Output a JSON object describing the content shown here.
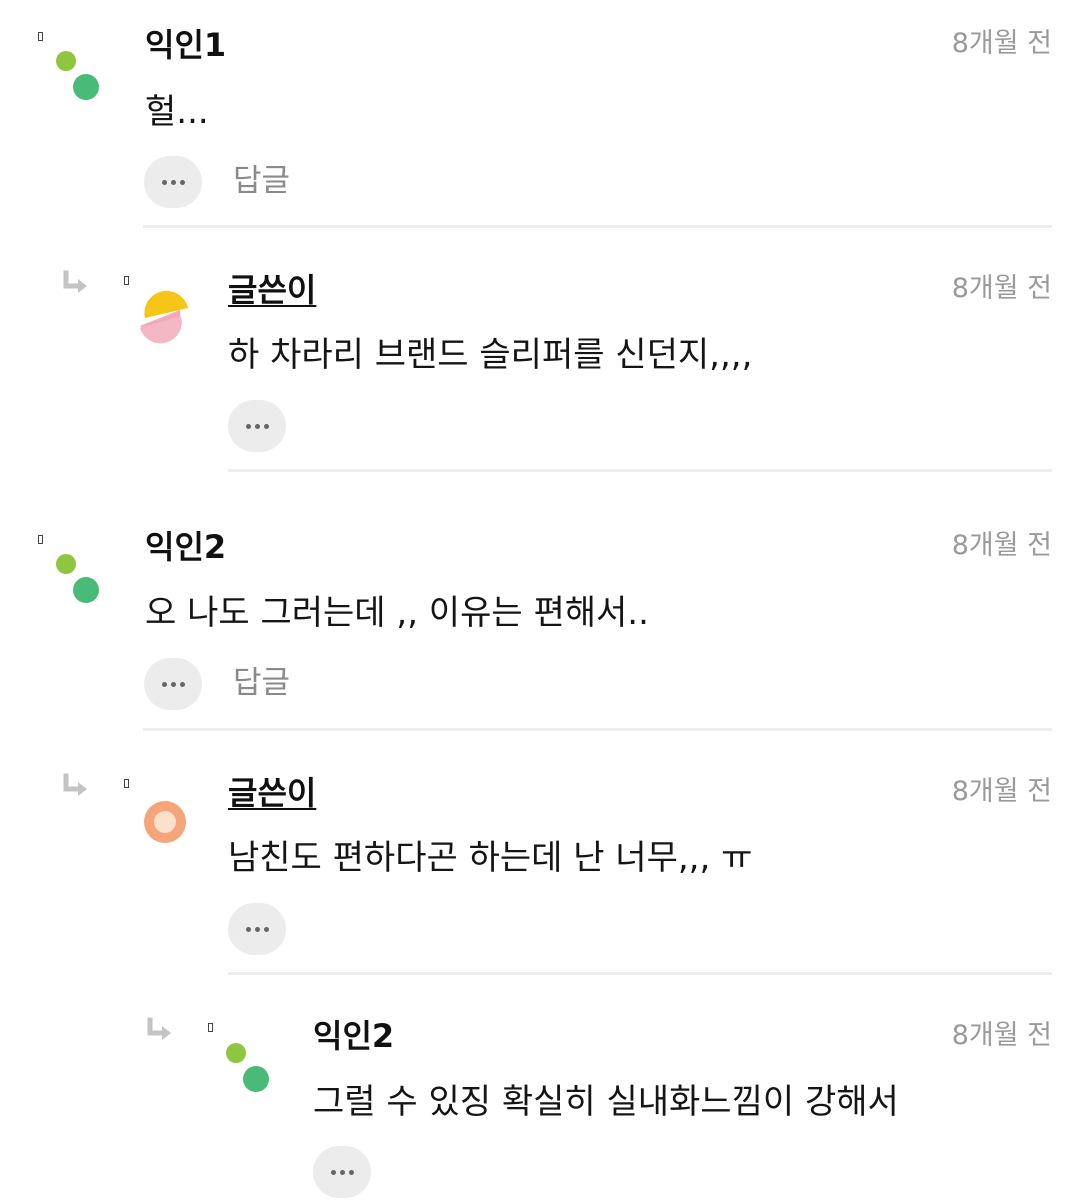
{
  "comments": [
    {
      "author": "익인1",
      "time": "8개월 전",
      "text": "헐...",
      "reply_label": "답글",
      "more_icon": "ellipsis-icon",
      "avatar_colors": [
        "#8fc540",
        "#48bb78"
      ]
    },
    {
      "author": "글쓴이",
      "time": "8개월 전",
      "text": "하 차라리 브랜드 슬리퍼를 신던지,,,,",
      "more_icon": "ellipsis-icon",
      "avatar_colors": [
        "#f5c518",
        "#f4a9b8"
      ]
    },
    {
      "author": "익인2",
      "time": "8개월 전",
      "text": "오 나도 그러는데 ,, 이유는 편해서..",
      "reply_label": "답글",
      "more_icon": "ellipsis-icon",
      "avatar_colors": [
        "#8fc540",
        "#48bb78"
      ]
    },
    {
      "author": "글쓴이",
      "time": "8개월 전",
      "text": "남친도 편하다곤 하는데 난 너무,,, ㅠ",
      "more_icon": "ellipsis-icon",
      "avatar_colors": [
        "#f4a57a",
        "#fde0cc"
      ]
    },
    {
      "author": "익인2",
      "time": "8개월 전",
      "text": "그럴 수 있징 확실히 실내화느낌이 강해서",
      "more_icon": "ellipsis-icon",
      "avatar_colors": [
        "#8fc540",
        "#48bb78"
      ]
    }
  ]
}
